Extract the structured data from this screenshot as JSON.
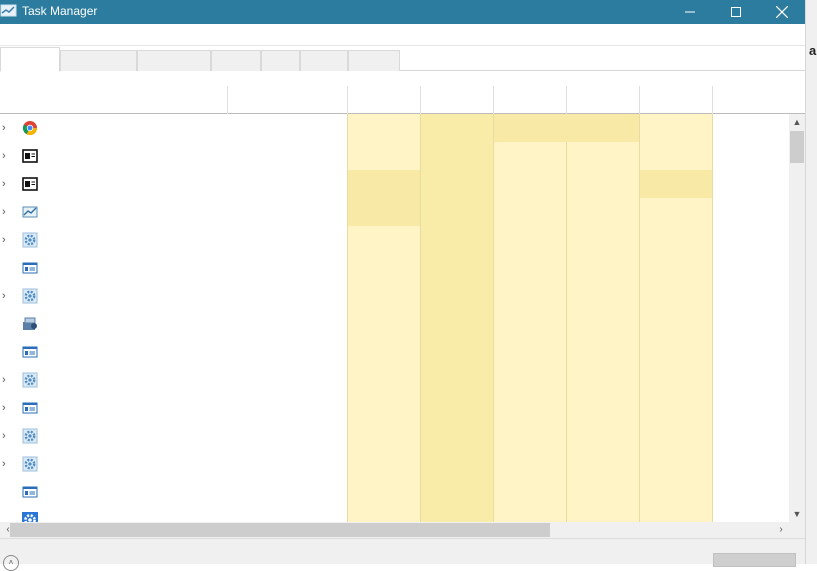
{
  "window": {
    "title": "Task Manager",
    "icon": "task-manager-icon",
    "controls": [
      "minimize-icon",
      "maximize-icon",
      "close-icon"
    ]
  },
  "background_window": {
    "visible_letter": "a"
  },
  "tabs_count": 7,
  "process_rows": [
    {
      "icon": "chrome-icon",
      "expandable": true
    },
    {
      "icon": "app-window-icon",
      "expandable": true
    },
    {
      "icon": "app-window-icon",
      "expandable": true
    },
    {
      "icon": "performance-monitor-icon",
      "expandable": true
    },
    {
      "icon": "service-gear-icon",
      "expandable": true
    },
    {
      "icon": "process-window-icon",
      "expandable": false
    },
    {
      "icon": "service-gear-icon",
      "expandable": true
    },
    {
      "icon": "media-tool-icon",
      "expandable": false
    },
    {
      "icon": "process-window-icon",
      "expandable": false
    },
    {
      "icon": "service-gear-icon",
      "expandable": true
    },
    {
      "icon": "process-window-icon",
      "expandable": true
    },
    {
      "icon": "service-gear-icon",
      "expandable": true
    },
    {
      "icon": "service-gear-icon",
      "expandable": true
    },
    {
      "icon": "process-window-icon",
      "expandable": false
    },
    {
      "icon": "gear-icon",
      "expandable": false
    }
  ],
  "colors": {
    "titlebar": "#2b7c9e",
    "cell_light": "#fff4c5",
    "cell_medium": "#f9eca8"
  }
}
